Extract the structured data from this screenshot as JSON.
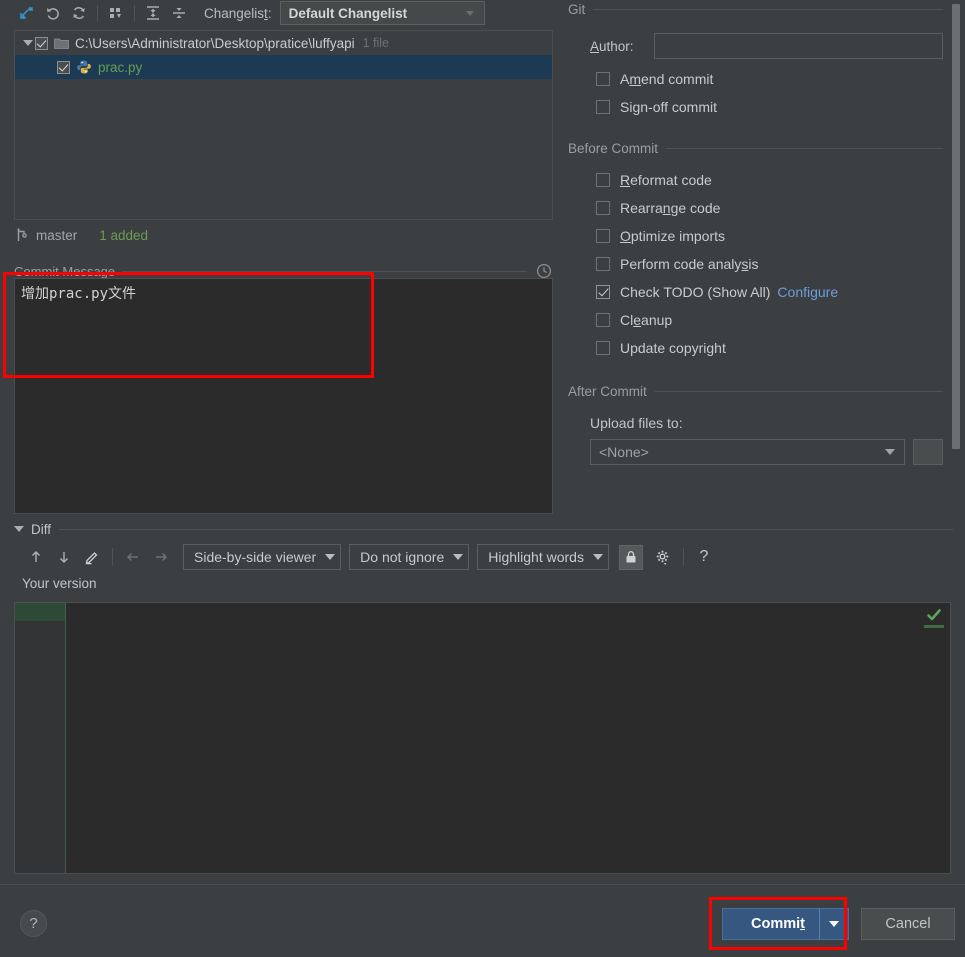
{
  "toolbar": {
    "icons": [
      {
        "name": "show-diff-icon",
        "title": "Show Diff"
      },
      {
        "name": "rollback-icon",
        "title": "Revert"
      },
      {
        "name": "refresh-icon",
        "title": "Refresh"
      },
      {
        "name": "group-by-icon",
        "title": "Group By"
      },
      {
        "name": "expand-all-icon",
        "title": "Expand All"
      },
      {
        "name": "collapse-all-icon",
        "title": "Collapse All"
      }
    ],
    "changelist_label": "Changelist:",
    "changelist_label_pre": "Changelis",
    "changelist_label_mnemonic": "t",
    "changelist_label_post": ":",
    "changelist_value": "Default Changelist"
  },
  "file_tree": {
    "root": {
      "path": "C:\\Users\\Administrator\\Desktop\\pratice\\luffyapi",
      "count": "1 file",
      "checked": true
    },
    "files": [
      {
        "name": "prac.py",
        "checked": true,
        "selected": true
      }
    ]
  },
  "branch_bar": {
    "branch": "master",
    "status": "1 added"
  },
  "commit_message": {
    "legend": "Commit Message",
    "value": "增加prac.py文件",
    "history_icon": "clock-icon"
  },
  "git_group": {
    "legend": "Git",
    "author_label": "Author:",
    "author_label_mnemonic": "A",
    "author_label_rest": "uthor:",
    "author_value": "",
    "options": [
      {
        "label": "Amend commit",
        "pre": "A",
        "mn": "m",
        "post": "end commit",
        "checked": false,
        "name": "amend-commit"
      },
      {
        "label": "Sign-off commit",
        "pre": "Si",
        "mn": "g",
        "post": "n-off commit",
        "checked": false,
        "name": "sign-off-commit"
      }
    ]
  },
  "before_commit": {
    "legend": "Before Commit",
    "options": [
      {
        "label": "Reformat code",
        "pre": "",
        "mn": "R",
        "post": "eformat code",
        "checked": false,
        "name": "reformat-code"
      },
      {
        "label": "Rearrange code",
        "pre": "Rearra",
        "mn": "n",
        "post": "ge code",
        "checked": false,
        "name": "rearrange-code"
      },
      {
        "label": "Optimize imports",
        "pre": "",
        "mn": "O",
        "post": "ptimize imports",
        "checked": false,
        "name": "optimize-imports"
      },
      {
        "label": "Perform code analysis",
        "pre": "Perform code analy",
        "mn": "s",
        "post": "is",
        "checked": false,
        "name": "perform-code-analysis"
      },
      {
        "label": "Check TODO (Show All)",
        "pre": "Check TODO (Show All)",
        "mn": "",
        "post": "",
        "checked": true,
        "name": "check-todo",
        "link": "Configure"
      },
      {
        "label": "Cleanup",
        "pre": "Cl",
        "mn": "e",
        "post": "anup",
        "checked": false,
        "name": "cleanup"
      },
      {
        "label": "Update copyright",
        "pre": "Update copyright",
        "mn": "",
        "post": "",
        "checked": false,
        "name": "update-copyright"
      }
    ]
  },
  "after_commit": {
    "legend": "After Commit",
    "upload_label": "Upload files to:",
    "upload_value": "<None>"
  },
  "diff": {
    "legend": "Diff",
    "your_version_label": "Your version",
    "toolbar": {
      "prev_icon": "arrow-up-icon",
      "next_icon": "arrow-down-icon",
      "edit_icon": "pencil-icon",
      "apply_left_icon": "arrow-left-icon",
      "apply_right_icon": "arrow-right-icon",
      "viewer_mode": "Side-by-side viewer",
      "ignore_mode": "Do not ignore",
      "highlight_mode": "Highlight words",
      "lock_icon": "lock-icon",
      "settings_icon": "gear-icon",
      "help_icon": "question-mark-icon"
    },
    "inspection_status": "ok-check-icon"
  },
  "bottom": {
    "help_label": "?",
    "commit_label": "Commit",
    "commit_label_pre": "Commi",
    "commit_label_mnemonic": "t",
    "cancel_label": "Cancel"
  },
  "colors": {
    "accent_blue": "#365880",
    "link_blue": "#6f9dd8",
    "added_green": "#6a9b52",
    "selection_navy": "#1c3a53",
    "annotation_red": "#ff0000",
    "panel_bg": "#3c3f41",
    "editor_bg": "#2b2b2b"
  }
}
